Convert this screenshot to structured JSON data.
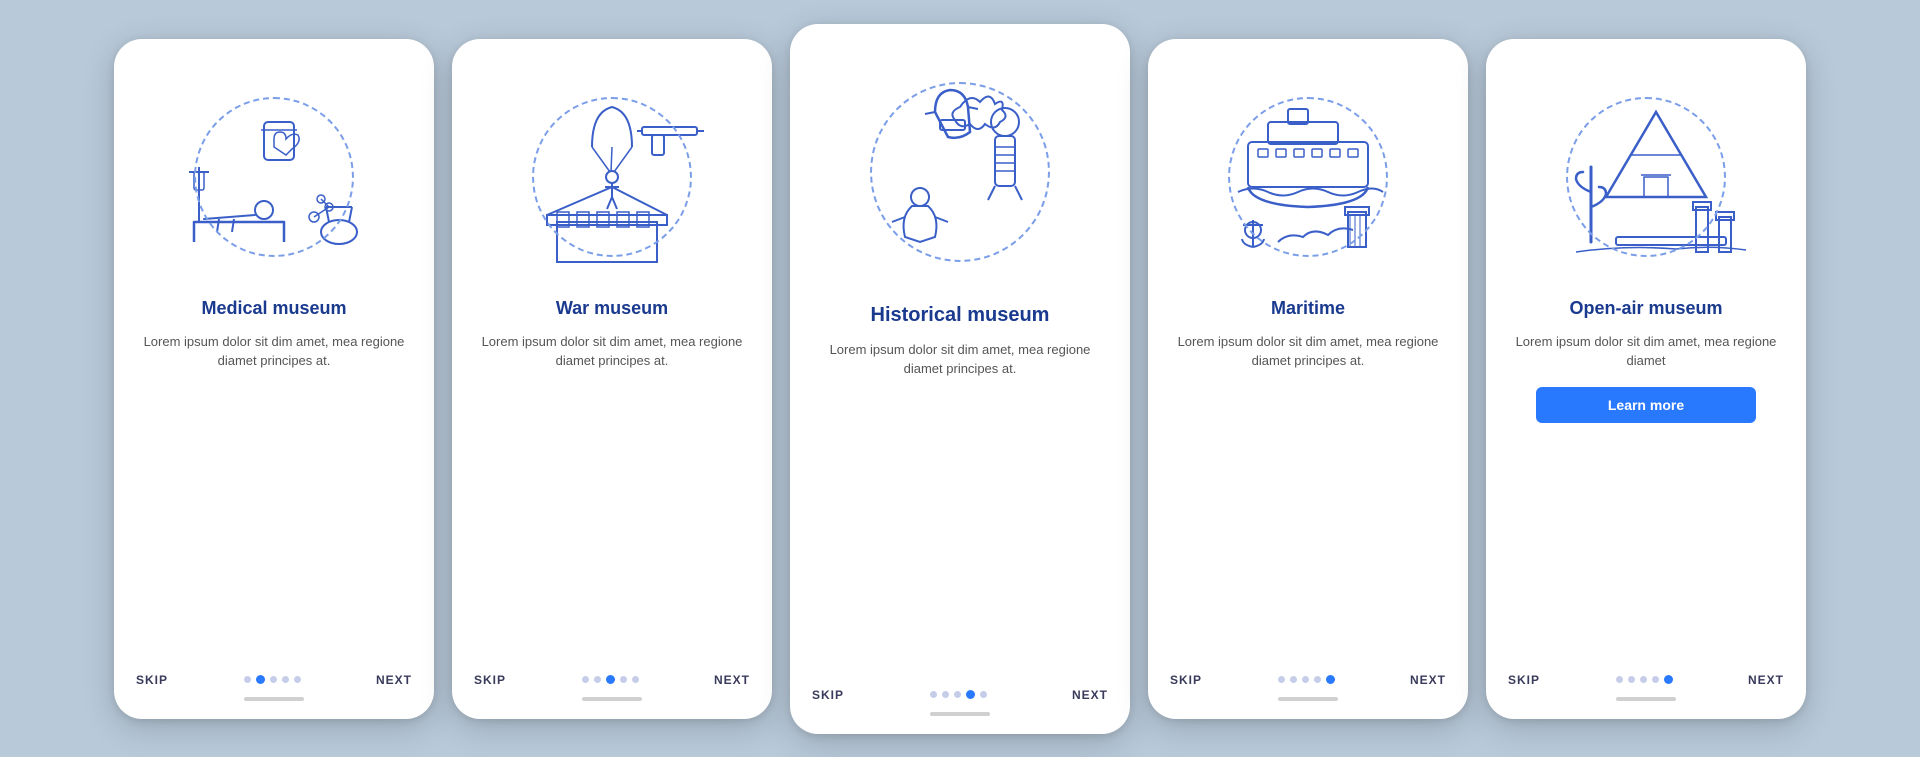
{
  "bg_color": "#b8c9d9",
  "screens": [
    {
      "id": "medical",
      "title": "Medical\nmuseum",
      "description": "Lorem ipsum dolor sit dim amet, mea regione diamet principes at.",
      "dots": [
        0,
        1,
        1,
        1,
        1
      ],
      "active_dot": 0,
      "has_learn_more": false,
      "skip_label": "SKIP",
      "next_label": "NEXT"
    },
    {
      "id": "war",
      "title": "War\nmuseum",
      "description": "Lorem ipsum dolor sit dim amet, mea regione diamet principes at.",
      "dots": [
        0,
        1,
        1,
        1,
        1
      ],
      "active_dot": 1,
      "has_learn_more": false,
      "skip_label": "SKIP",
      "next_label": "NEXT"
    },
    {
      "id": "historical",
      "title": "Historical\nmuseum",
      "description": "Lorem ipsum dolor sit dim amet, mea regione diamet principes at.",
      "dots": [
        0,
        0,
        1,
        1,
        1
      ],
      "active_dot": 2,
      "has_learn_more": false,
      "skip_label": "SKIP",
      "next_label": "NEXT"
    },
    {
      "id": "maritime",
      "title": "Maritime",
      "description": "Lorem ipsum dolor sit dim amet, mea regione diamet principes at.",
      "dots": [
        0,
        0,
        0,
        1,
        1
      ],
      "active_dot": 3,
      "has_learn_more": false,
      "skip_label": "SKIP",
      "next_label": "NEXT"
    },
    {
      "id": "openair",
      "title": "Open-air\nmuseum",
      "description": "Lorem ipsum dolor sit dim amet, mea regione diamet",
      "dots": [
        0,
        0,
        0,
        0,
        1
      ],
      "active_dot": 4,
      "has_learn_more": true,
      "learn_more_label": "Learn more",
      "skip_label": "SKIP",
      "next_label": "NEXT"
    }
  ]
}
